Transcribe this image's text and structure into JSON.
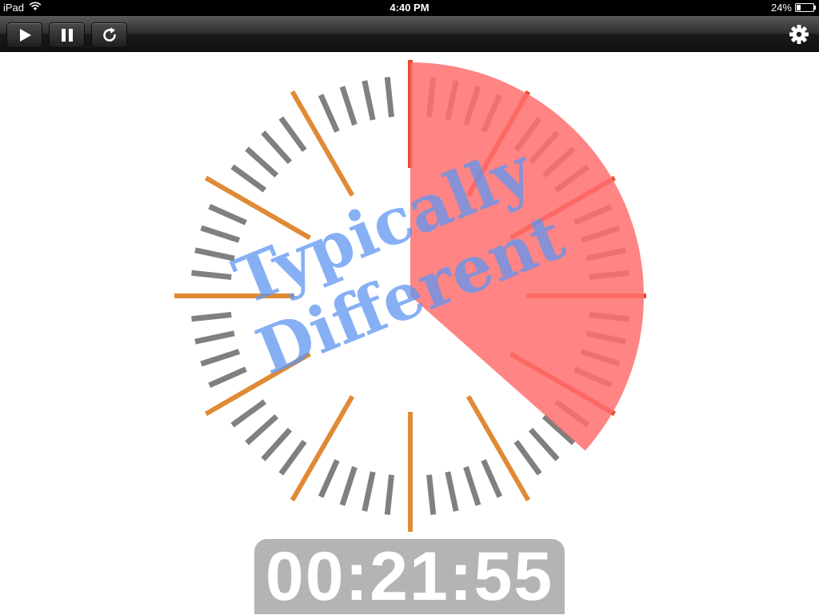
{
  "status_bar": {
    "device": "iPad",
    "time": "4:40 PM",
    "battery": "24%",
    "battery_level": 0.24,
    "wifi_icon": "wifi-icon",
    "battery_icon": "battery-icon"
  },
  "toolbar": {
    "play_icon": "play-icon",
    "pause_icon": "pause-icon",
    "reset_icon": "refresh-icon",
    "settings_icon": "gear-icon"
  },
  "timer": {
    "display": "00:21:55",
    "elapsed_fraction": 0.3653,
    "wedge_color": "#ff6e6e",
    "major_tick_color": "#e08a35",
    "minor_tick_color": "#808080",
    "active_tick_color": "#e84a2a"
  },
  "watermark": {
    "line1": "Typically",
    "line2": "Different"
  }
}
